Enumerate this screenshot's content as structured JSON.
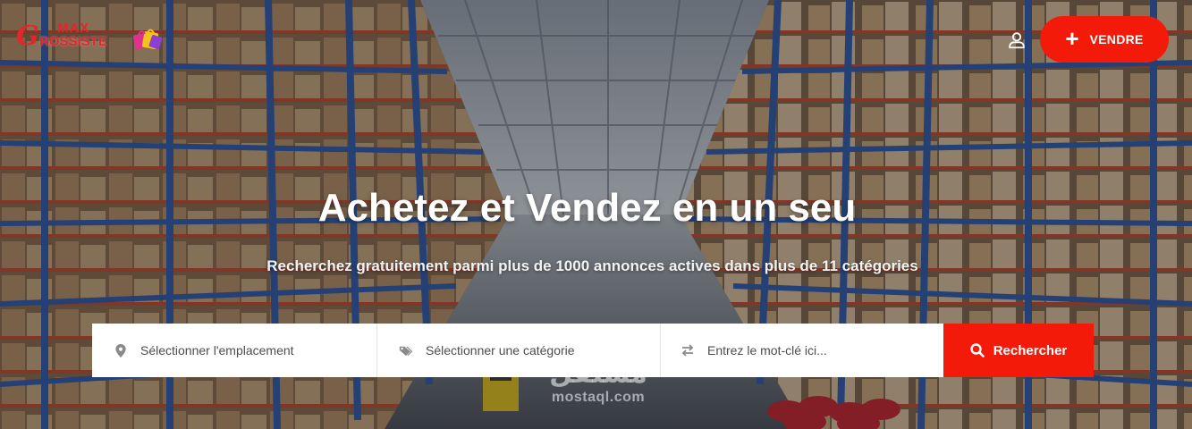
{
  "header": {
    "logo": {
      "line1": "MAX",
      "line2": "ROSSISTE",
      "initial": "G"
    },
    "user_icon": "user-icon",
    "sell_button": {
      "icon": "plus-icon",
      "label": "VENDRE"
    }
  },
  "hero": {
    "title": "Achetez et Vendez en un seu",
    "subtitle": "Recherchez gratuitement parmi plus de 1000 annonces actives dans plus de 11 catégories"
  },
  "search": {
    "location": {
      "icon": "map-pin-icon",
      "placeholder": "Sélectionner l'emplacement"
    },
    "category": {
      "icon": "tags-icon",
      "placeholder": "Sélectionner une catégorie"
    },
    "keyword": {
      "icon": "swap-arrows-icon",
      "placeholder": "Entrez le mot-clé ici..."
    },
    "submit": {
      "icon": "search-icon",
      "label": "Rechercher"
    }
  },
  "watermark": {
    "arabic": "مستقل",
    "latin": "mostaql.com"
  },
  "colors": {
    "accent": "#f41a0a",
    "logo_red": "#e4262b",
    "shelf_blue": "#2f5aa8",
    "shelf_orange": "#c8502a"
  }
}
